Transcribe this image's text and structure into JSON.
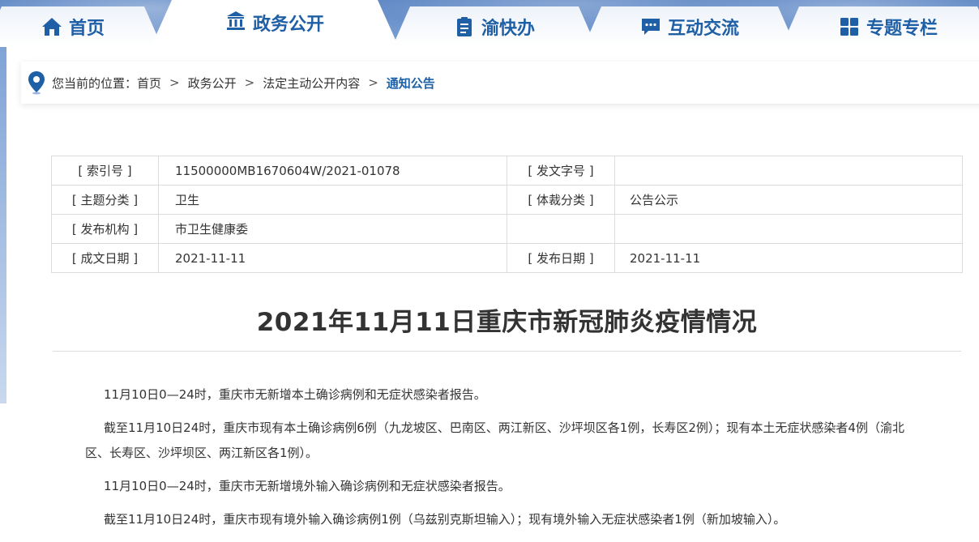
{
  "nav": {
    "items": [
      {
        "label": "首页",
        "icon": "home-icon"
      },
      {
        "label": "政务公开",
        "icon": "building-icon"
      },
      {
        "label": "渝快办",
        "icon": "clipboard-icon"
      },
      {
        "label": "互动交流",
        "icon": "chat-icon"
      },
      {
        "label": "专题专栏",
        "icon": "grid-icon"
      }
    ],
    "active_index": 1
  },
  "breadcrumb": {
    "prefix": "您当前的位置：",
    "items": [
      "首页",
      "政务公开",
      "法定主动公开内容"
    ],
    "current": "通知公告",
    "separator": ">"
  },
  "meta": {
    "index_no_label": "[ 索引号 ]",
    "index_no_value": "11500000MB1670604W/2021-01078",
    "doc_no_label": "[ 发文字号 ]",
    "doc_no_value": "",
    "topic_label": "[ 主题分类 ]",
    "topic_value": "卫生",
    "genre_label": "[ 体裁分类 ]",
    "genre_value": "公告公示",
    "issuer_label": "[ 发布机构 ]",
    "issuer_value": "市卫生健康委",
    "created_label": "[ 成文日期 ]",
    "created_value": "2021-11-11",
    "published_label": "[ 发布日期 ]",
    "published_value": "2021-11-11"
  },
  "article": {
    "title": "2021年11月11日重庆市新冠肺炎疫情情况",
    "paragraphs": [
      "11月10日0—24时，重庆市无新增本土确诊病例和无症状感染者报告。",
      "截至11月10日24时，重庆市现有本土确诊病例6例（九龙坡区、巴南区、两江新区、沙坪坝区各1例，长寿区2例）；现有本土无症状感染者4例（渝北区、长寿区、沙坪坝区、两江新区各1例）。",
      "11月10日0—24时，重庆市无新增境外输入确诊病例和无症状感染者报告。",
      "截至11月10日24时，重庆市现有境外输入确诊病例1例（乌兹别克斯坦输入）；现有境外输入无症状感染者1例（新加坡输入）。"
    ]
  },
  "colors": {
    "accent": "#1f5fa6",
    "nav_bg": "#6f96cf",
    "border": "#dcdcdc"
  }
}
